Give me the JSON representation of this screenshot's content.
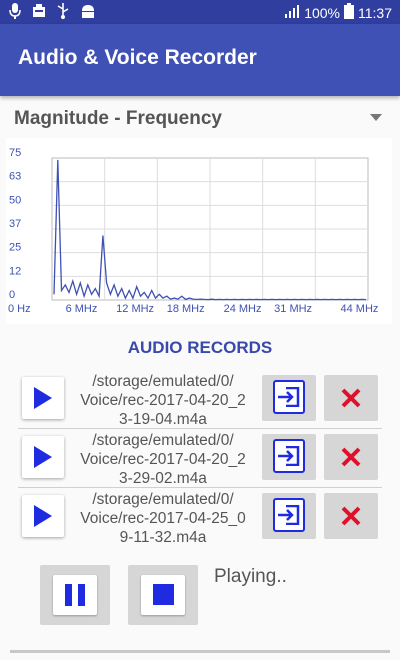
{
  "status_bar": {
    "battery": "100%",
    "time": "11:37",
    "icons_left": [
      "mic-icon",
      "notification-icon",
      "usb-icon",
      "android-icon"
    ],
    "icons_right": [
      "signal-icon",
      "battery-icon"
    ]
  },
  "app_bar": {
    "title": "Audio & Voice Recorder"
  },
  "spinner": {
    "selected": "Magnitude - Frequency"
  },
  "chart_data": {
    "type": "line",
    "y_ticks": [
      "75",
      "63",
      "50",
      "37",
      "25",
      "12",
      "0"
    ],
    "x_ticks": [
      "0 Hz",
      "6 MHz",
      "12 MHz",
      "18 MHz",
      "24 MHz",
      "31 MHz",
      "44 MHz"
    ],
    "ylim": [
      0,
      75
    ],
    "grid": true,
    "series": [
      {
        "values": [
          3,
          74,
          5,
          8,
          4,
          10,
          3,
          9,
          2,
          8,
          3,
          6,
          2,
          34,
          9,
          3,
          8,
          2,
          6,
          1,
          5,
          1,
          7,
          2,
          4,
          1,
          5,
          1,
          3,
          1,
          2,
          0.5,
          1,
          0.5,
          2,
          0.3,
          1,
          0.5,
          0.3,
          0.5,
          0.3,
          0.2,
          0.4,
          0.2,
          0.3,
          0.2,
          0.3,
          0.2,
          0.3,
          0.2,
          0.3,
          0.2,
          0.3,
          0.2,
          0.3,
          0.2,
          0.3,
          0.2,
          0.3,
          0.2,
          0.3,
          0.2,
          0.3,
          0.2,
          0.3,
          0.2,
          0.3,
          0.2,
          0.3,
          0.2,
          0.3,
          0.2,
          0.3,
          0.2,
          0.3,
          0.2,
          0.3,
          0.2,
          0.3,
          0.2,
          0.3,
          0.2,
          0.3,
          0.2
        ]
      }
    ],
    "color": "#3f51b5"
  },
  "records_section": {
    "title": "AUDIO RECORDS"
  },
  "records": [
    {
      "path": "/storage/emulated/0/\nVoice/rec-2017-04-20_2\n3-19-04.m4a"
    },
    {
      "path": "/storage/emulated/0/\nVoice/rec-2017-04-20_2\n3-29-02.m4a"
    },
    {
      "path": "/storage/emulated/0/\nVoice/rec-2017-04-25_0\n9-11-32.m4a"
    }
  ],
  "player": {
    "status": "Playing.."
  },
  "colors": {
    "primary": "#3f51b5",
    "primary_dark": "#303f9f",
    "action_blue": "#1e2be0",
    "delete_red": "#e0102a"
  }
}
